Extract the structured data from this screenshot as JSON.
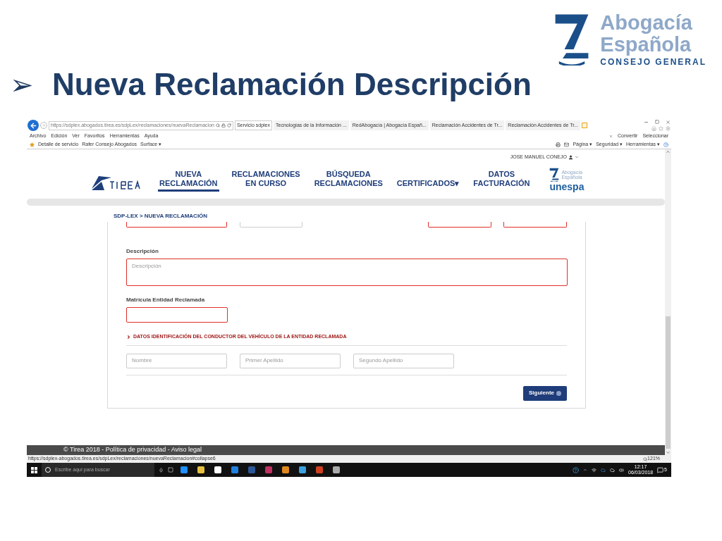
{
  "slide": {
    "logo": {
      "line1": "Abogacía",
      "line2": "Española",
      "line3": "CONSEJO GENERAL"
    },
    "bullet": "➢",
    "title": "Nueva Reclamación Descripción"
  },
  "browser": {
    "url": "https://sdplex.abogados.tirea.es/sdpLex/reclamaciones/nuevaReclamacion",
    "tabs": [
      {
        "label": "Servicio sdplex",
        "selected": true
      },
      {
        "label": "Tecnologías de la Información ...",
        "selected": false
      },
      {
        "label": "RedAbogacía | Abogacía Españ...",
        "selected": false
      },
      {
        "label": "Reclamación Accidentes de Tr...",
        "selected": false
      },
      {
        "label": "Reclamación Accidentes de Tr...",
        "selected": false
      }
    ],
    "menu": [
      "Archivo",
      "Edición",
      "Ver",
      "Favoritos",
      "Herramientas",
      "Ayuda"
    ],
    "favorites": [
      "Detalle de servicio",
      "Rafer Consejo Abogados",
      "Surface ▾"
    ],
    "convert": [
      "Convertir",
      "Seleccionar"
    ],
    "commands": [
      "Página ▾",
      "Seguridad ▾",
      "Herramientas ▾"
    ],
    "status_url": "https://sdplex-abogados.tirea.es/sdpLex/reclamaciones/nuevaReclamacion#collapse6",
    "zoom": "121%"
  },
  "page": {
    "user": "JOSE MANUEL CONEJO",
    "nav": [
      {
        "label": "NUEVA\nRECLAMACIÓN",
        "selected": true
      },
      {
        "label": "RECLAMACIONES\nEN CURSO",
        "selected": false
      },
      {
        "label": "BÚSQUEDA\nRECLAMACIONES",
        "selected": false
      },
      {
        "label": "CERTIFICADOS▾",
        "selected": false
      },
      {
        "label": "DATOS\nFACTURACIÓN",
        "selected": false
      }
    ],
    "partner_logo": {
      "line1": "Abogacía",
      "line2": "Española",
      "line4": "unespa"
    },
    "breadcrumb": "SDP-LEX > NUEVA RECLAMACIÓN",
    "top_fields": [
      {
        "invalid": true
      },
      {
        "invalid": false
      },
      {
        "invalid": true
      },
      {
        "invalid": true
      }
    ],
    "fields": [
      {
        "kind": "textarea",
        "label": "Descripción",
        "placeholder": "Descripción",
        "invalid": true
      },
      {
        "kind": "input",
        "label": "Matrícula Entidad Reclamada",
        "invalid": true
      }
    ],
    "section_title": "DATOS IDENTIFICACIÓN DEL CONDUCTOR DEL VEHÍCULO DE LA ENTIDAD RECLAMADA",
    "driver_fields": [
      {
        "placeholder": "Nombre",
        "invalid": false
      },
      {
        "placeholder": "Primer Apellido",
        "invalid": false
      },
      {
        "placeholder": "Segundo Apellido",
        "invalid": false
      }
    ],
    "next_button": "Siguiente",
    "footer": "© Tirea 2018 - Política de privacidad - Aviso legal"
  },
  "taskbar": {
    "search_placeholder": "Escribe aquí para buscar",
    "time": "12:17",
    "date": "06/03/2018",
    "notifications": "5"
  }
}
